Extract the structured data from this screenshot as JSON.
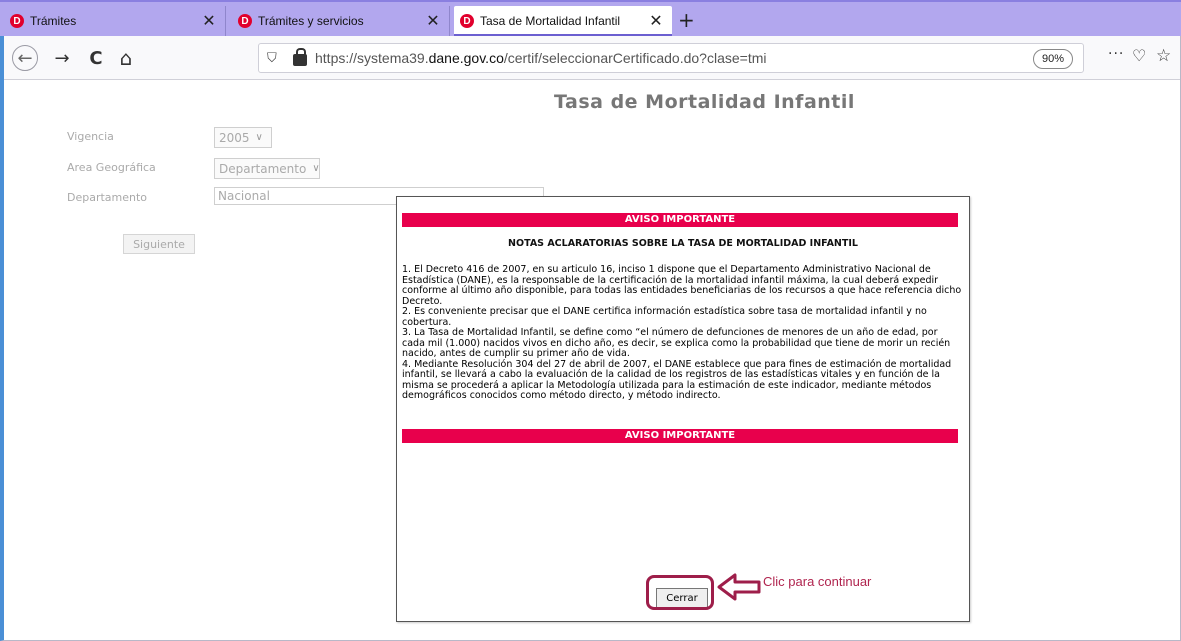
{
  "browser": {
    "tabs": [
      {
        "title": "Trámites",
        "active": false
      },
      {
        "title": "Trámites y servicios",
        "active": false
      },
      {
        "title": "Tasa de Mortalidad Infantil",
        "active": true
      }
    ],
    "new_tab_glyph": "+",
    "close_glyph": "✕",
    "url_prefix": "https://systema39.",
    "url_domain": "dane.gov.co",
    "url_suffix": "/certif/seleccionarCertificado.do?clase=tmi",
    "zoom": "90%",
    "menu_glyph": "···",
    "pocket_glyph": "♡",
    "star_glyph": "☆",
    "back_glyph": "←",
    "forward_glyph": "→",
    "reload_glyph": "C",
    "home_glyph": "⌂",
    "shield_glyph": "⛉",
    "accent_color": "#b2a7ee"
  },
  "page": {
    "title": "Tasa de Mortalidad Infantil",
    "form": {
      "vigencia_label": "Vigencia",
      "vigencia_value": "2005",
      "area_label": "Area Geográfica",
      "area_value": "Departamento",
      "departamento_label": "Departamento",
      "departamento_value": "Nacional",
      "next_button": "Siguiente"
    }
  },
  "modal": {
    "banner_top": "AVISO IMPORTANTE",
    "heading": "NOTAS ACLARATORIAS SOBRE LA TASA DE MORTALIDAD INFANTIL",
    "notes": [
      "1. El Decreto 416 de 2007, en su articulo 16, inciso 1 dispone que el Departamento Administrativo Nacional de Estadística (DANE), es la responsable de la certificación de la mortalidad infantil máxima, la cual deberá expedir conforme al último año disponible, para todas las entidades beneficiarias de los recursos a que hace referencia dicho Decreto.",
      "2. Es conveniente precisar que el DANE certifica información estadística sobre tasa de mortalidad infantil y no cobertura.",
      "3. La Tasa de Mortalidad Infantil, se define como “el número de defunciones de menores de un año de edad, por cada mil (1.000) nacidos vivos en dicho año, es decir, se explica como la probabilidad que tiene de morir un recién nacido, antes de cumplir su primer año de vida.",
      "4. Mediante Resolución 304 del 27 de abril de 2007, el DANE establece que para fines de estimación de mortalidad infantil, se llevará a cabo la evaluación de la calidad de los registros de las estadísticas vitales y en función de la misma se procederá a aplicar la Metodología utilizada para la estimación de este indicador, mediante métodos demográficos conocidos como método directo, y método indirecto."
    ],
    "banner_bottom": "AVISO IMPORTANTE",
    "close_button": "Cerrar",
    "banner_color": "#e8004c"
  },
  "annotation": {
    "hint": "Clic para continuar",
    "color": "#9e1e4a"
  }
}
